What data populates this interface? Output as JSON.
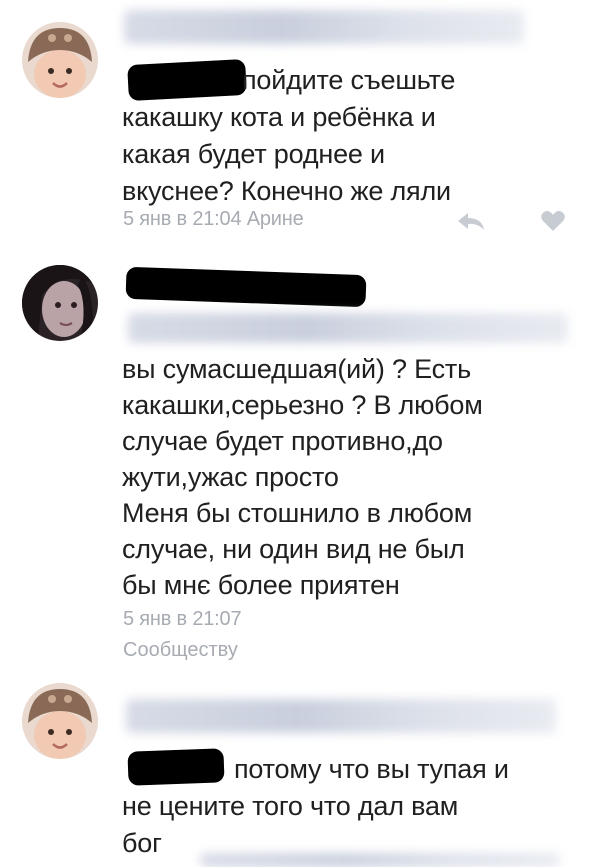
{
  "comments": [
    {
      "text": "пойдите съешьте\nкакашку кота и ребёнка и\nкакая будет роднее и\nвкуснее? Конечно же ляли",
      "time": "5 янв в 21:04",
      "reply_to": "Арине"
    },
    {
      "text": "вы сумасшедшая(ий) ? Есть\nкакашки,серьезно ? В любом\nслучае будет противно,до\nжути,ужас просто\nМеня бы стошнило в любом\nслучае, ни один вид не был\nбы мнє более приятен",
      "time": "5 янв в 21:07",
      "reply_to": "Сообществу"
    },
    {
      "text": "потому что вы тупая и\nне цените того что дал вам\nбог"
    }
  ],
  "icons": {
    "reply": "reply-arrow-icon",
    "like": "heart-icon"
  },
  "colors": {
    "meta_text": "#a7abb2",
    "body_text": "#202020"
  }
}
